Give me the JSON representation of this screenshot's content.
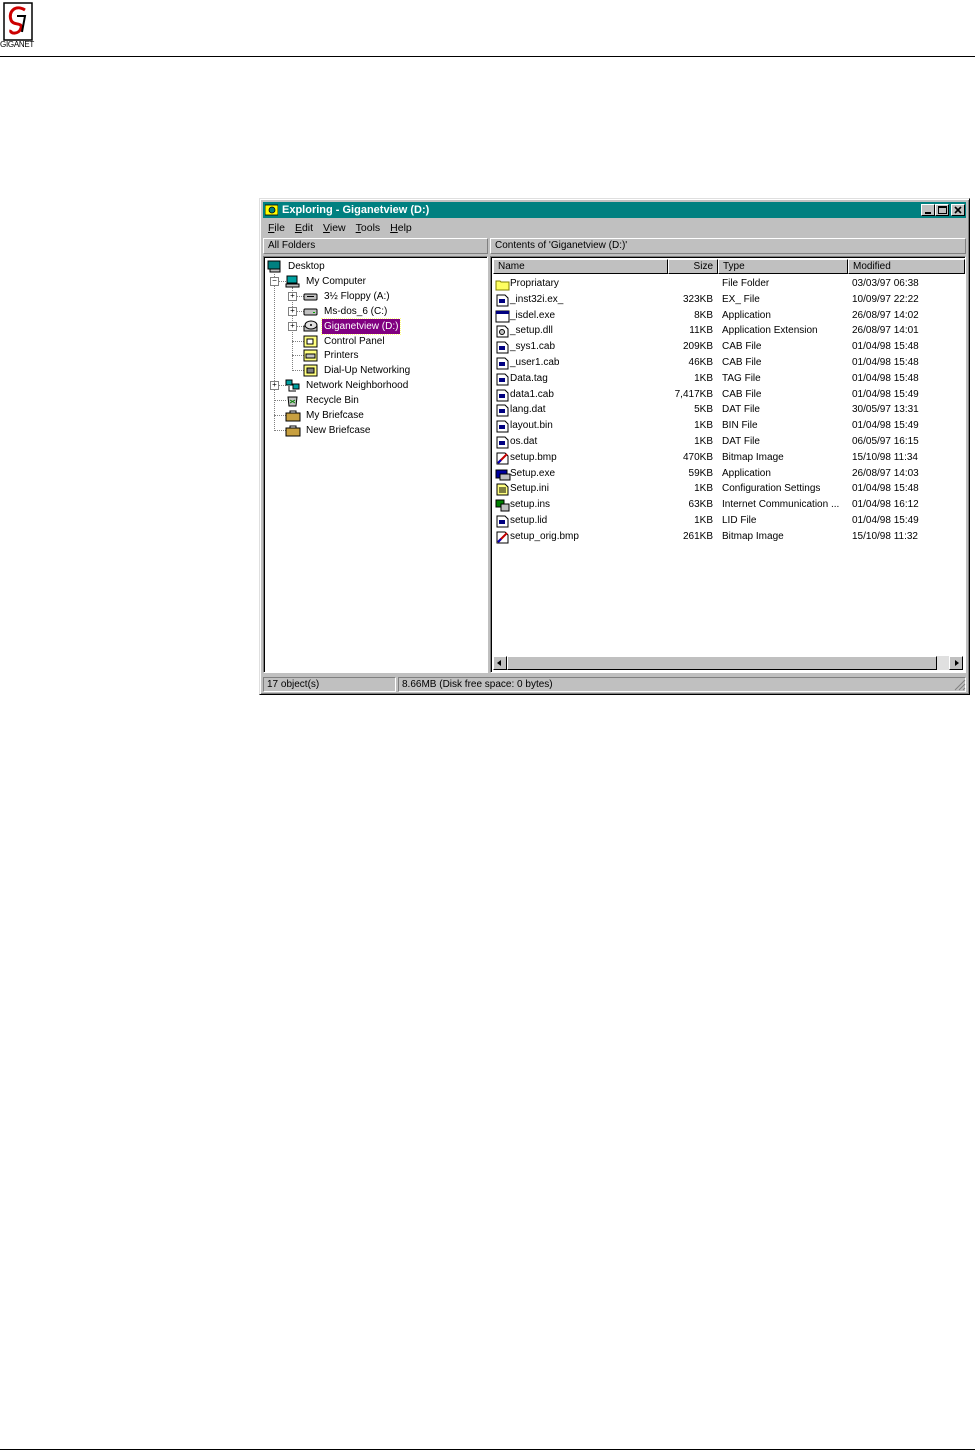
{
  "page": {
    "logo_text": "GIGANET"
  },
  "window": {
    "title": "Exploring - Giganetview (D:)",
    "menu": [
      {
        "label": "File",
        "ul": "F",
        "rest": "ile"
      },
      {
        "label": "Edit",
        "ul": "E",
        "rest": "dit"
      },
      {
        "label": "View",
        "ul": "V",
        "rest": "iew"
      },
      {
        "label": "Tools",
        "ul": "T",
        "rest": "ools"
      },
      {
        "label": "Help",
        "ul": "H",
        "rest": "elp"
      }
    ],
    "left_header": "All Folders",
    "right_header": "Contents of 'Giganetview (D:)'"
  },
  "tree": [
    {
      "label": "Desktop",
      "icon": "desktop-icon",
      "level": 0
    },
    {
      "label": "My Computer",
      "icon": "computer-icon",
      "level": 1,
      "expander": "-"
    },
    {
      "label": "3½ Floppy (A:)",
      "icon": "floppy-drive-icon",
      "level": 2,
      "expander": "+"
    },
    {
      "label": "Ms-dos_6 (C:)",
      "icon": "hard-drive-icon",
      "level": 2,
      "expander": "+"
    },
    {
      "label": "Giganetview (D:)",
      "icon": "cd-drive-icon",
      "level": 2,
      "expander": "+",
      "selected": true
    },
    {
      "label": "Control Panel",
      "icon": "control-panel-icon",
      "level": 2
    },
    {
      "label": "Printers",
      "icon": "printers-icon",
      "level": 2
    },
    {
      "label": "Dial-Up Networking",
      "icon": "dialup-icon",
      "level": 2
    },
    {
      "label": "Network Neighborhood",
      "icon": "network-icon",
      "level": 1,
      "expander": "+"
    },
    {
      "label": "Recycle Bin",
      "icon": "recycle-bin-icon",
      "level": 1
    },
    {
      "label": "My Briefcase",
      "icon": "briefcase-icon",
      "level": 1
    },
    {
      "label": "New Briefcase",
      "icon": "briefcase-icon",
      "level": 1
    }
  ],
  "columns": [
    "Name",
    "Size",
    "Type",
    "Modified"
  ],
  "files": [
    {
      "name": "Propriatary",
      "size": "",
      "type": "File Folder",
      "modified": "03/03/97 06:38",
      "icon": "folder-icon"
    },
    {
      "name": "_inst32i.ex_",
      "size": "323KB",
      "type": "EX_ File",
      "modified": "10/09/97 22:22",
      "icon": "file-icon"
    },
    {
      "name": "_isdel.exe",
      "size": "8KB",
      "type": "Application",
      "modified": "26/08/97 14:02",
      "icon": "app-icon"
    },
    {
      "name": "_setup.dll",
      "size": "11KB",
      "type": "Application Extension",
      "modified": "26/08/97 14:01",
      "icon": "dll-icon"
    },
    {
      "name": "_sys1.cab",
      "size": "209KB",
      "type": "CAB File",
      "modified": "01/04/98 15:48",
      "icon": "file-icon"
    },
    {
      "name": "_user1.cab",
      "size": "46KB",
      "type": "CAB File",
      "modified": "01/04/98 15:48",
      "icon": "file-icon"
    },
    {
      "name": "Data.tag",
      "size": "1KB",
      "type": "TAG File",
      "modified": "01/04/98 15:48",
      "icon": "file-icon"
    },
    {
      "name": "data1.cab",
      "size": "7,417KB",
      "type": "CAB File",
      "modified": "01/04/98 15:49",
      "icon": "file-icon"
    },
    {
      "name": "lang.dat",
      "size": "5KB",
      "type": "DAT File",
      "modified": "30/05/97 13:31",
      "icon": "file-icon"
    },
    {
      "name": "layout.bin",
      "size": "1KB",
      "type": "BIN File",
      "modified": "01/04/98 15:49",
      "icon": "file-icon"
    },
    {
      "name": "os.dat",
      "size": "1KB",
      "type": "DAT File",
      "modified": "06/05/97 16:15",
      "icon": "file-icon"
    },
    {
      "name": "setup.bmp",
      "size": "470KB",
      "type": "Bitmap Image",
      "modified": "15/10/98 11:34",
      "icon": "bitmap-icon"
    },
    {
      "name": "Setup.exe",
      "size": "59KB",
      "type": "Application",
      "modified": "26/08/97 14:03",
      "icon": "setup-exe-icon"
    },
    {
      "name": "Setup.ini",
      "size": "1KB",
      "type": "Configuration Settings",
      "modified": "01/04/98 15:48",
      "icon": "ini-icon"
    },
    {
      "name": "setup.ins",
      "size": "63KB",
      "type": "Internet Communication ...",
      "modified": "01/04/98 16:12",
      "icon": "ins-icon"
    },
    {
      "name": "setup.lid",
      "size": "1KB",
      "type": "LID File",
      "modified": "01/04/98 15:49",
      "icon": "file-icon"
    },
    {
      "name": "setup_orig.bmp",
      "size": "261KB",
      "type": "Bitmap Image",
      "modified": "15/10/98 11:32",
      "icon": "bitmap-icon"
    }
  ],
  "status": {
    "objects": "17 object(s)",
    "space": "8.66MB (Disk free space: 0 bytes)"
  },
  "colors": {
    "titlebar": "#008080",
    "selection": "#800080",
    "face": "#c0c0c0"
  }
}
